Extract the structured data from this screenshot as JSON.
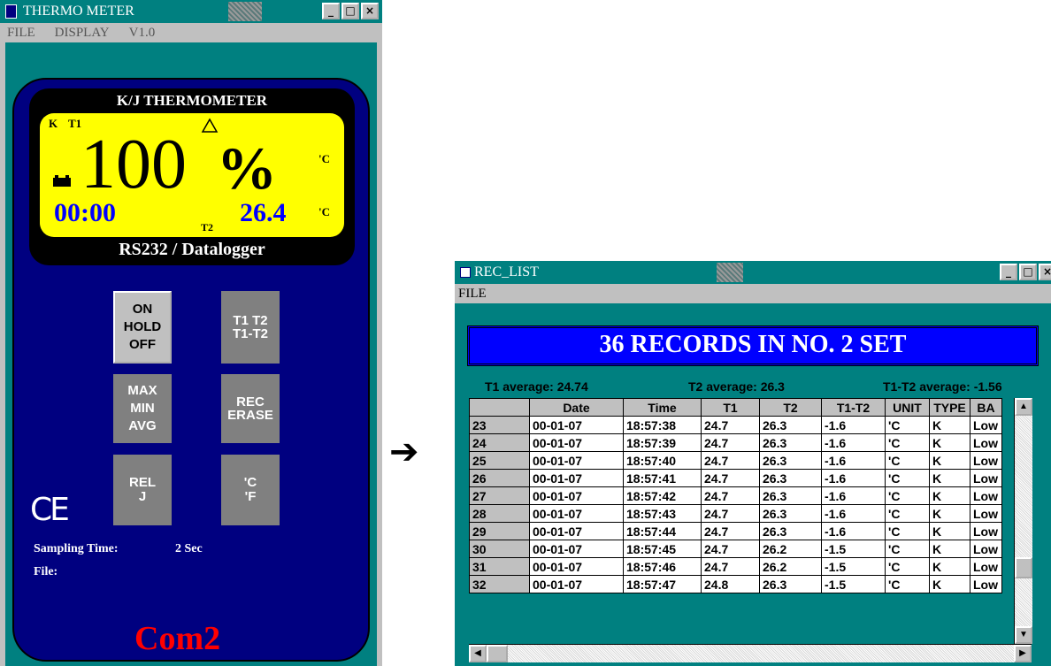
{
  "thermo": {
    "title": "THERMO METER",
    "menu": [
      "FILE",
      "DISPLAY",
      "V1.0"
    ],
    "window_buttons": {
      "minimize": "_",
      "maximize": "□",
      "close": "×"
    },
    "lcd_title": "K/J THERMOMETER",
    "probe_type": "K",
    "t1_label": "T1",
    "t2_label": "T2",
    "main_value": "100",
    "main_unit": "%",
    "unit_top": "'C",
    "unit_bottom": "'C",
    "time_value": "00:00",
    "t2_value": "26.4",
    "lcd_subtitle": "RS232 / Datalogger",
    "buttons": {
      "power": [
        "ON",
        "HOLD",
        "OFF"
      ],
      "channel": [
        "T1 T2",
        "T1-T2"
      ],
      "stats": [
        "MAX",
        "MIN",
        "AVG"
      ],
      "record": [
        "REC",
        "ERASE"
      ],
      "relative": [
        "REL",
        "J"
      ],
      "units": [
        "'C",
        "'F"
      ]
    },
    "ce_mark": "CE",
    "sampling_label": "Sampling Time:",
    "sampling_value": "2 Sec",
    "file_label": "File:",
    "port": "Com2"
  },
  "reclist": {
    "title": "REC_LIST",
    "menu": [
      "FILE"
    ],
    "window_buttons": {
      "minimize": "_",
      "maximize": "□",
      "close": "×"
    },
    "banner": "36  RECORDS IN NO.  2  SET",
    "t1_average": "T1 average: 24.74",
    "t2_average": "T2 average: 26.3",
    "diff_average": "T1-T2 average: -1.56",
    "columns": [
      "",
      "Date",
      "Time",
      "T1",
      "T2",
      "T1-T2",
      "UNIT",
      "TYPE",
      "BA"
    ],
    "rows": [
      [
        "23",
        "00-01-07",
        "18:57:38",
        "24.7",
        "26.3",
        "-1.6",
        "'C",
        "K",
        "Low"
      ],
      [
        "24",
        "00-01-07",
        "18:57:39",
        "24.7",
        "26.3",
        "-1.6",
        "'C",
        "K",
        "Low"
      ],
      [
        "25",
        "00-01-07",
        "18:57:40",
        "24.7",
        "26.3",
        "-1.6",
        "'C",
        "K",
        "Low"
      ],
      [
        "26",
        "00-01-07",
        "18:57:41",
        "24.7",
        "26.3",
        "-1.6",
        "'C",
        "K",
        "Low"
      ],
      [
        "27",
        "00-01-07",
        "18:57:42",
        "24.7",
        "26.3",
        "-1.6",
        "'C",
        "K",
        "Low"
      ],
      [
        "28",
        "00-01-07",
        "18:57:43",
        "24.7",
        "26.3",
        "-1.6",
        "'C",
        "K",
        "Low"
      ],
      [
        "29",
        "00-01-07",
        "18:57:44",
        "24.7",
        "26.3",
        "-1.6",
        "'C",
        "K",
        "Low"
      ],
      [
        "30",
        "00-01-07",
        "18:57:45",
        "24.7",
        "26.2",
        "-1.5",
        "'C",
        "K",
        "Low"
      ],
      [
        "31",
        "00-01-07",
        "18:57:46",
        "24.7",
        "26.2",
        "-1.5",
        "'C",
        "K",
        "Low"
      ],
      [
        "32",
        "00-01-07",
        "18:57:47",
        "24.8",
        "26.3",
        "-1.5",
        "'C",
        "K",
        "Low"
      ]
    ],
    "scroll_arrows": {
      "up": "▲",
      "down": "▼",
      "left": "◀",
      "right": "▶"
    }
  },
  "arrow": "➔",
  "colors": {
    "teal": "#008080",
    "navy": "#000080",
    "lcd": "#ffff00",
    "blue_digits": "#0000ff",
    "red": "#ff0000",
    "banner": "#0000ff"
  }
}
